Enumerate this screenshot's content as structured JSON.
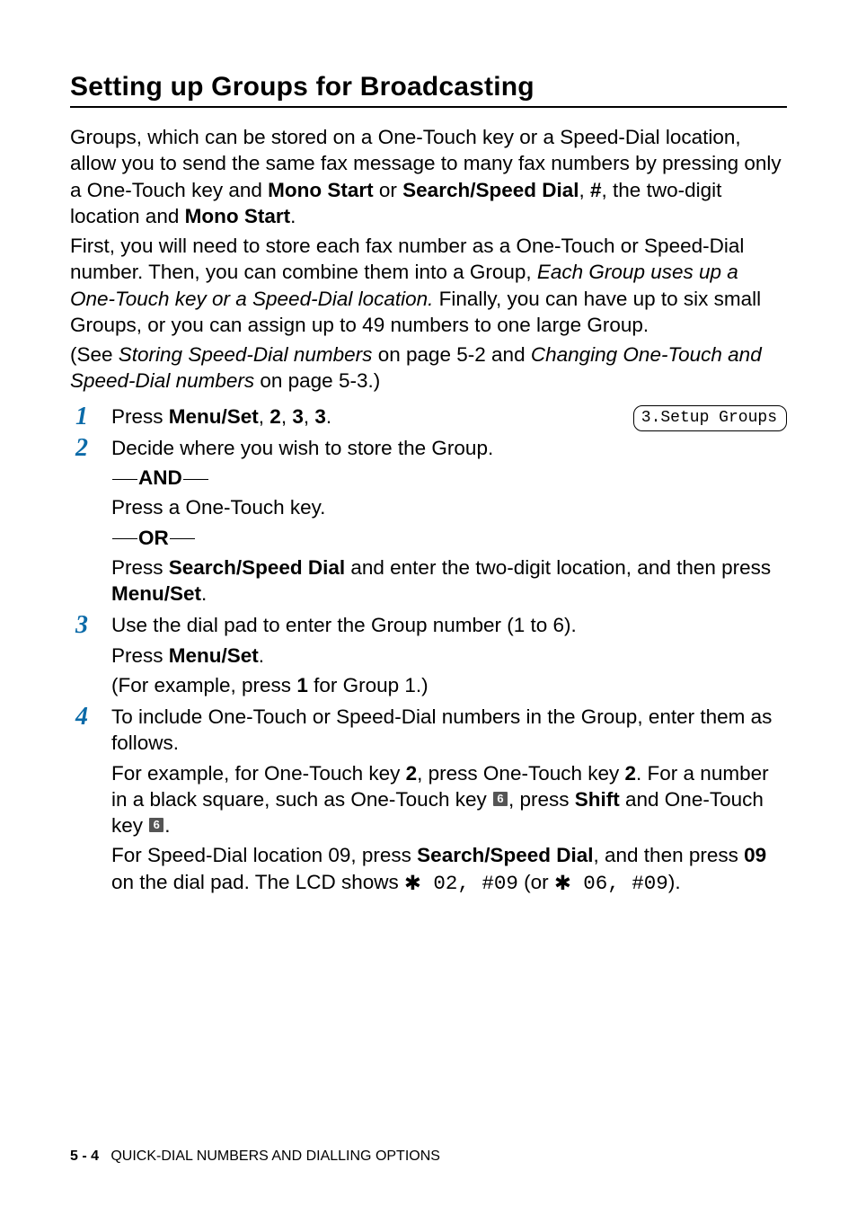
{
  "title": "Setting up Groups for Broadcasting",
  "intro": {
    "p1a": "Groups, which can be stored on a One-Touch key or a Speed-Dial location, allow you to send the same fax message to many fax numbers by pressing only a One-Touch key and ",
    "p1b": "Mono Start",
    "p1c": " or ",
    "p1d": "Search/Speed Dial",
    "p1e": ", ",
    "p1f": "#",
    "p1g": ", the two-digit location and ",
    "p1h": "Mono Start",
    "p1i": ".",
    "p2a": "First, you will need to store each fax number as a One-Touch or Speed-Dial number. Then, you can combine them into a Group, ",
    "p2b": "Each Group uses up a One-Touch key or a Speed-Dial location.",
    "p2c": " Finally, you can have up to six small Groups, or you can assign up to 49 numbers to one large Group.",
    "p3a": "(See ",
    "p3b": "Storing Speed-Dial numbers",
    "p3c": " on page 5-2 and ",
    "p3d": "Changing One-Touch and Speed-Dial numbers",
    "p3e": " on page 5-3.)"
  },
  "lcd": "3.Setup Groups",
  "steps": {
    "s1": {
      "num": "1",
      "a": "Press ",
      "b": "Menu/Set",
      "c": ", ",
      "d": "2",
      "e": ", ",
      "f": "3",
      "g": ", ",
      "h": "3",
      "i": "."
    },
    "s2": {
      "num": "2",
      "p1": "Decide where you wish to store the Group.",
      "and": "AND",
      "p2": "Press a One-Touch key.",
      "or": "OR",
      "p3a": "Press ",
      "p3b": "Search/Speed Dial",
      "p3c": " and enter the two-digit location, and then press ",
      "p3d": "Menu/Set",
      "p3e": "."
    },
    "s3": {
      "num": "3",
      "p1": "Use the dial pad to enter the Group number (1 to 6).",
      "p2a": "Press ",
      "p2b": "Menu/Set",
      "p2c": ".",
      "p3a": "(For example, press ",
      "p3b": "1",
      "p3c": " for Group 1.)"
    },
    "s4": {
      "num": "4",
      "p1": "To include One-Touch or Speed-Dial numbers in the Group, enter them as follows.",
      "p2a": "For example, for One-Touch key ",
      "p2b": "2",
      "p2c": ", press One-Touch key ",
      "p2d": "2",
      "p2e": ". For a number in a black square, such as One-Touch key ",
      "p2key1": "6",
      "p2f": ", press ",
      "p2g": "Shift",
      "p2h": " and One-Touch key ",
      "p2key2": "6",
      "p2i": ".",
      "p3a": "For Speed-Dial location 09, press ",
      "p3b": "Search/Speed Dial",
      "p3c": ", and then press ",
      "p3d": "09",
      "p3e": " on the dial pad. The LCD shows ",
      "p3mono1": " 02, #09",
      "p3f": " (or ",
      "p3mono2": " 06, #09",
      "p3g": ")."
    }
  },
  "footer": {
    "page": "5 - 4",
    "label": "QUICK-DIAL NUMBERS AND DIALLING OPTIONS"
  }
}
